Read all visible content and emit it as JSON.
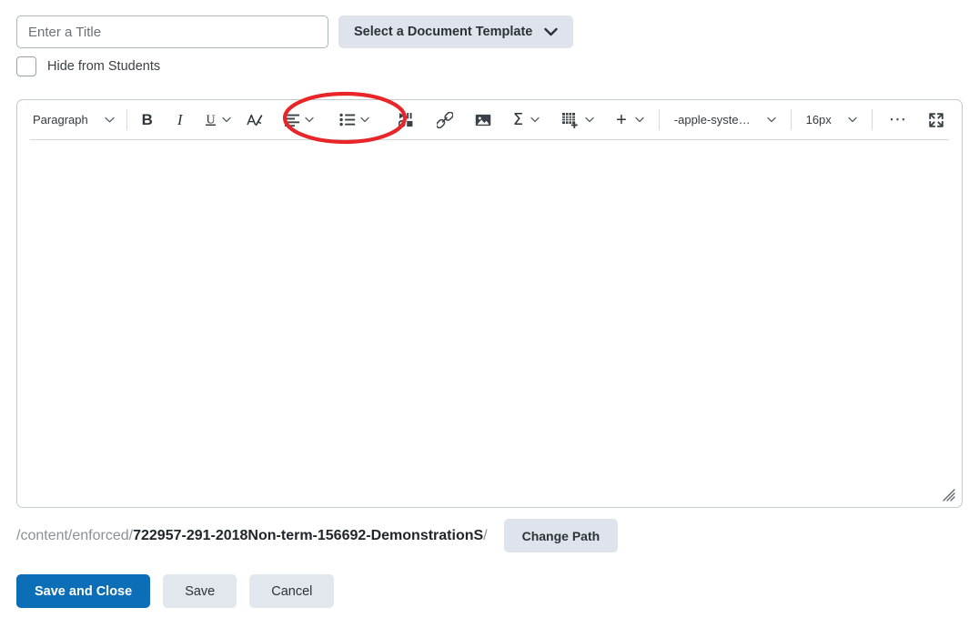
{
  "form": {
    "title_input": {
      "value": "",
      "placeholder": "Enter a Title"
    },
    "template_button": {
      "label": "Select a Document Template",
      "icon": "chevron-down-icon"
    },
    "hide_from_students": {
      "label": "Hide from Students",
      "checked": false
    }
  },
  "editor": {
    "toolbar": {
      "paragraph_style": {
        "label": "Paragraph",
        "icon": "chevron-down-icon"
      },
      "bold": {
        "label": "B",
        "icon": "bold-icon"
      },
      "italic": {
        "label": "I",
        "icon": "italic-icon"
      },
      "underline": {
        "label": "U",
        "icon": "underline-icon"
      },
      "format_painter": {
        "icon": "text-style-icon"
      },
      "align": {
        "icon": "align-left-icon"
      },
      "list": {
        "icon": "bullet-list-icon"
      },
      "insert_stuff": {
        "icon": "insert-stuff-icon"
      },
      "quicklink": {
        "icon": "link-icon"
      },
      "image": {
        "icon": "image-icon"
      },
      "equation": {
        "label": "Σ",
        "icon": "sigma-icon"
      },
      "table": {
        "icon": "table-add-icon"
      },
      "insert": {
        "label": "+",
        "icon": "plus-icon"
      },
      "font_family": {
        "value": "-apple-syste…",
        "icon": "chevron-down-icon"
      },
      "font_size": {
        "value": "16px",
        "icon": "chevron-down-icon"
      },
      "more_options": {
        "icon": "ellipsis-icon"
      },
      "fullscreen": {
        "icon": "expand-icon"
      }
    },
    "content": "",
    "resize_handle": {
      "icon": "resize-grip-icon"
    }
  },
  "annotation": {
    "shape": "ellipse",
    "color": "#e8262a",
    "targets": "align-dropdown and list-dropdown toolbar buttons"
  },
  "path": {
    "prefix": "/content/enforced/",
    "main": "722957-291-2018Non-term-156692-DemonstrationS",
    "suffix": "/",
    "change_button": "Change Path"
  },
  "footer": {
    "save_and_close": "Save and Close",
    "save": "Save",
    "cancel": "Cancel"
  },
  "colors": {
    "primary": "#0d6eb8",
    "secondary_button": "#e2e6ed",
    "template_button": "#dfe4ec",
    "annotation_red": "#e8262a"
  }
}
